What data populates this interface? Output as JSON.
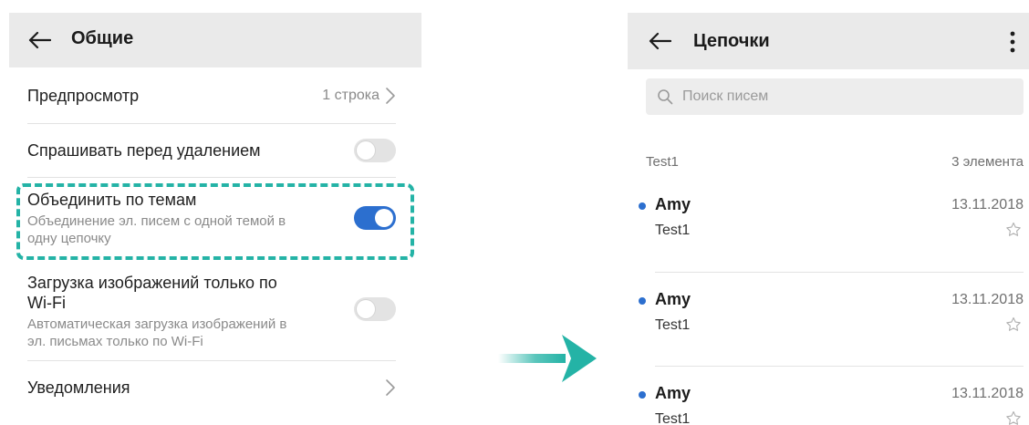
{
  "settings": {
    "title": "Общие",
    "preview": {
      "label": "Предпросмотр",
      "value": "1 строка"
    },
    "confirm_delete": {
      "label": "Спрашивать перед удалением",
      "enabled": false
    },
    "group_by_subject": {
      "label": "Объединить по темам",
      "desc_line1": "Объединение эл. писем с одной темой в",
      "desc_line2": "одну цепочку",
      "enabled": true
    },
    "wifi_images": {
      "label_line1": "Загрузка изображений только по",
      "label_line2": "Wi-Fi",
      "desc_line1": "Автоматическая загрузка изображений в",
      "desc_line2": "эл. письмах только по Wi-Fi",
      "enabled": false
    },
    "notifications": {
      "label": "Уведомления"
    }
  },
  "threads": {
    "title": "Цепочки",
    "search": {
      "placeholder": "Поиск писем",
      "value": ""
    },
    "group": {
      "name": "Test1",
      "count": "3 элемента"
    },
    "items": [
      {
        "sender": "Amy",
        "subject": "Test1",
        "date": "13.11.2018",
        "unread": true,
        "starred": false
      },
      {
        "sender": "Amy",
        "subject": "Test1",
        "date": "13.11.2018",
        "unread": true,
        "starred": false
      },
      {
        "sender": "Amy",
        "subject": "Test1",
        "date": "13.11.2018",
        "unread": true,
        "starred": false
      }
    ]
  },
  "colors": {
    "accent": "#2c6fcf",
    "highlight": "#24b3a6",
    "topbar": "#eaeaea"
  },
  "icons": [
    "back-arrow-icon",
    "chevron-right-icon",
    "more-vertical-icon",
    "search-icon",
    "star-outline-icon",
    "forward-arrow-icon"
  ]
}
